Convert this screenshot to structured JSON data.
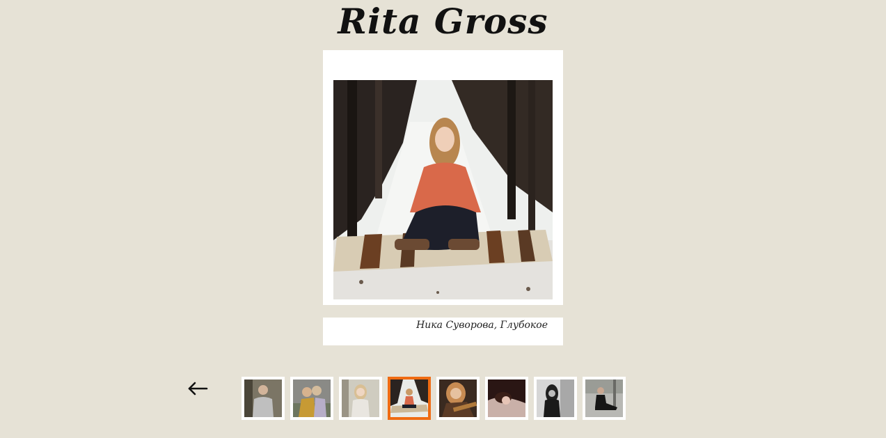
{
  "site": {
    "title": "Rita Gross"
  },
  "gallery": {
    "caption": "Ника Суворова, Глубокое",
    "prev_icon": "left-arrow-icon",
    "thumbnails": [
      {
        "scene": "man-grey-sweatshirt-forest"
      },
      {
        "scene": "girls-hugging-outdoors"
      },
      {
        "scene": "blonde-girl-in-nature"
      },
      {
        "scene": "girl-sitting-snowy-forest",
        "active": true
      },
      {
        "scene": "girl-with-guitar"
      },
      {
        "scene": "girl-lying-dark-portrait"
      },
      {
        "scene": "girl-dark-monochrome"
      },
      {
        "scene": "girl-sitting-by-trees"
      }
    ],
    "accent": "#f06b12",
    "background": "#e6e2d6"
  }
}
